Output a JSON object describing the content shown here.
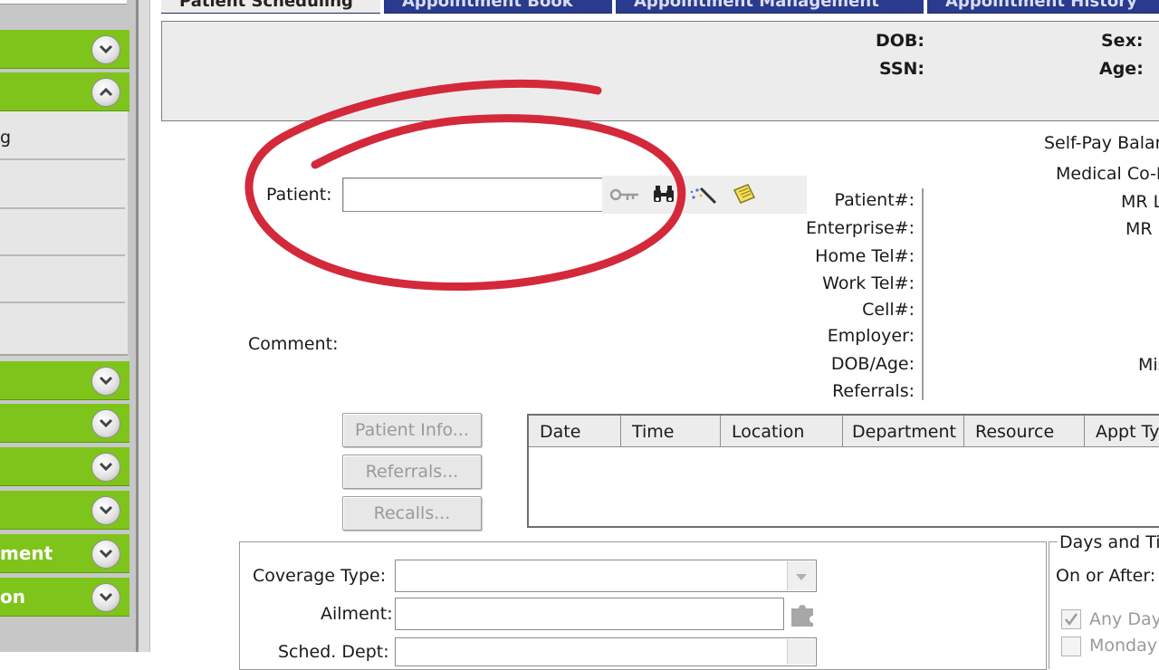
{
  "tabs": [
    {
      "label": "Patient Scheduling",
      "active": true
    },
    {
      "label": "Appointment Book",
      "active": false
    },
    {
      "label": "Appointment Management",
      "active": false
    },
    {
      "label": "Appointment History",
      "active": false
    }
  ],
  "sidebar": {
    "row_partial_label": "g",
    "bars": [
      "",
      "",
      "",
      "",
      "",
      "ment",
      "on"
    ]
  },
  "header": {
    "dob_label": "DOB:",
    "sex_label": "Sex:",
    "ssn_label": "SSN:",
    "age_label": "Age:"
  },
  "patient": {
    "label": "Patient:",
    "value": "",
    "comment_label": "Comment:"
  },
  "info_labels": [
    "Patient#:",
    "Enterprise#:",
    "Home Tel#:",
    "Work Tel#:",
    "Cell#:",
    "Employer:",
    "DOB/Age:",
    "Referrals:"
  ],
  "right_info": {
    "self_pay": "Self-Pay Balar",
    "medical_copay": "Medical Co-P",
    "mr1": "MR L",
    "mr2": "MR I",
    "mis": "Mis"
  },
  "buttons": {
    "patient_info": "Patient Info...",
    "referrals": "Referrals...",
    "recalls": "Recalls..."
  },
  "grid": {
    "columns": [
      "Date",
      "Time",
      "Location",
      "Department",
      "Resource",
      "Appt Ty"
    ]
  },
  "form": {
    "coverage_type_label": "Coverage Type:",
    "ailment_label": "Ailment:",
    "sched_dept_label": "Sched. Dept:"
  },
  "days_times": {
    "title": "Days and Ti",
    "on_or_after": "On or After:",
    "any_day": "Any Day",
    "monday": "Monday"
  },
  "colors": {
    "sidebar_green": "#7fc41a",
    "tab_blue": "#2a3a8c",
    "annotation_red": "#d3293a"
  }
}
